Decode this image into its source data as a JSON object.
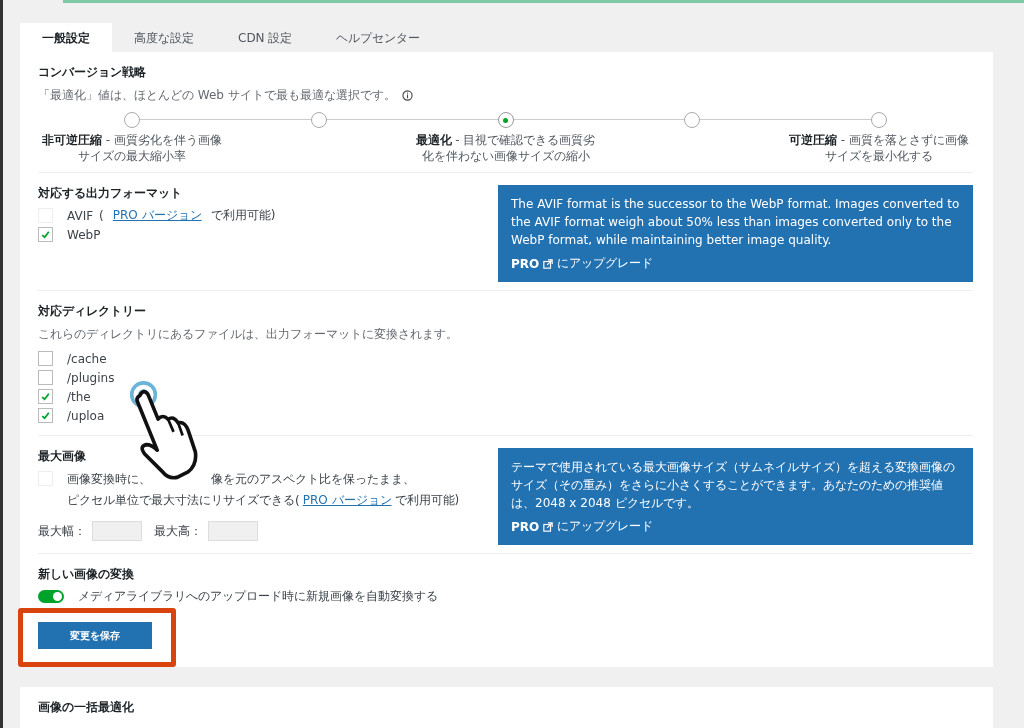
{
  "tabs": [
    {
      "label": "一般設定",
      "selected": true
    },
    {
      "label": "高度な設定",
      "selected": false
    },
    {
      "label": "CDN 設定",
      "selected": false
    },
    {
      "label": "ヘルプセンター",
      "selected": false
    }
  ],
  "strategy": {
    "title": "コンバージョン戦略",
    "hint": "「最適化」値は、ほとんどの Web サイトで最も最適な選択です。",
    "options": [
      {
        "selected": false,
        "name": "非可逆圧縮",
        "desc": "- 画質劣化を伴う画像サイズの最大縮小率"
      },
      {
        "selected": false
      },
      {
        "selected": true,
        "name": "最適化",
        "desc": "- 目視で確認できる画質劣化を伴わない画像サイズの縮小"
      },
      {
        "selected": false
      },
      {
        "selected": false,
        "name": "可逆圧縮",
        "desc": "- 画質を落とさずに画像サイズを最小化する"
      }
    ]
  },
  "formats": {
    "title": "対応する出力フォーマット",
    "items": [
      {
        "label": "AVIF",
        "checked": false,
        "disabled": true,
        "pre": "(",
        "link": "PRO バージョン",
        "post": "で利用可能)"
      },
      {
        "label": "WebP",
        "checked": true,
        "disabled": false
      }
    ],
    "info": "The AVIF format is the successor to the WebP format. Images converted to the AVIF format weigh about 50% less than images converted only to the WebP format, while maintaining better image quality.",
    "pro": "PRO",
    "upgrade": "にアップグレード"
  },
  "directories": {
    "title": "対応ディレクトリー",
    "hint": "これらのディレクトリにあるファイルは、出力フォーマットに変換されます。",
    "items": [
      {
        "label": "/cache",
        "checked": false
      },
      {
        "label": "/plugins",
        "checked": false
      },
      {
        "label": "/the",
        "checked": true
      },
      {
        "label": "/uploa",
        "checked": true
      }
    ]
  },
  "max_size": {
    "title": "最大画像",
    "checked": false,
    "desc_parts": [
      "画像変換時に、",
      "像を元のアスペクト比を保ったまま、",
      "ピクセル単位で最大寸法にリサイズできる"
    ],
    "pre": "(",
    "link": "PRO バージョン",
    "post": "で利用可能)",
    "width_label": "最大幅：",
    "height_label": "最大高：",
    "info": "テーマで使用されている最大画像サイズ（サムネイルサイズ）を超える変換画像のサイズ（その重み）をさらに小さくすることができます。あなたのための推奨値は、2048 x 2048 ピクセルです。",
    "pro": "PRO",
    "upgrade": "にアップグレード"
  },
  "auto_convert": {
    "title": "新しい画像の変換",
    "on": true,
    "label": "メディアライブラリへのアップロード時に新規画像を自動変換する"
  },
  "save_button": "変更を保存",
  "bulk": {
    "title": "画像の一括最適化"
  }
}
